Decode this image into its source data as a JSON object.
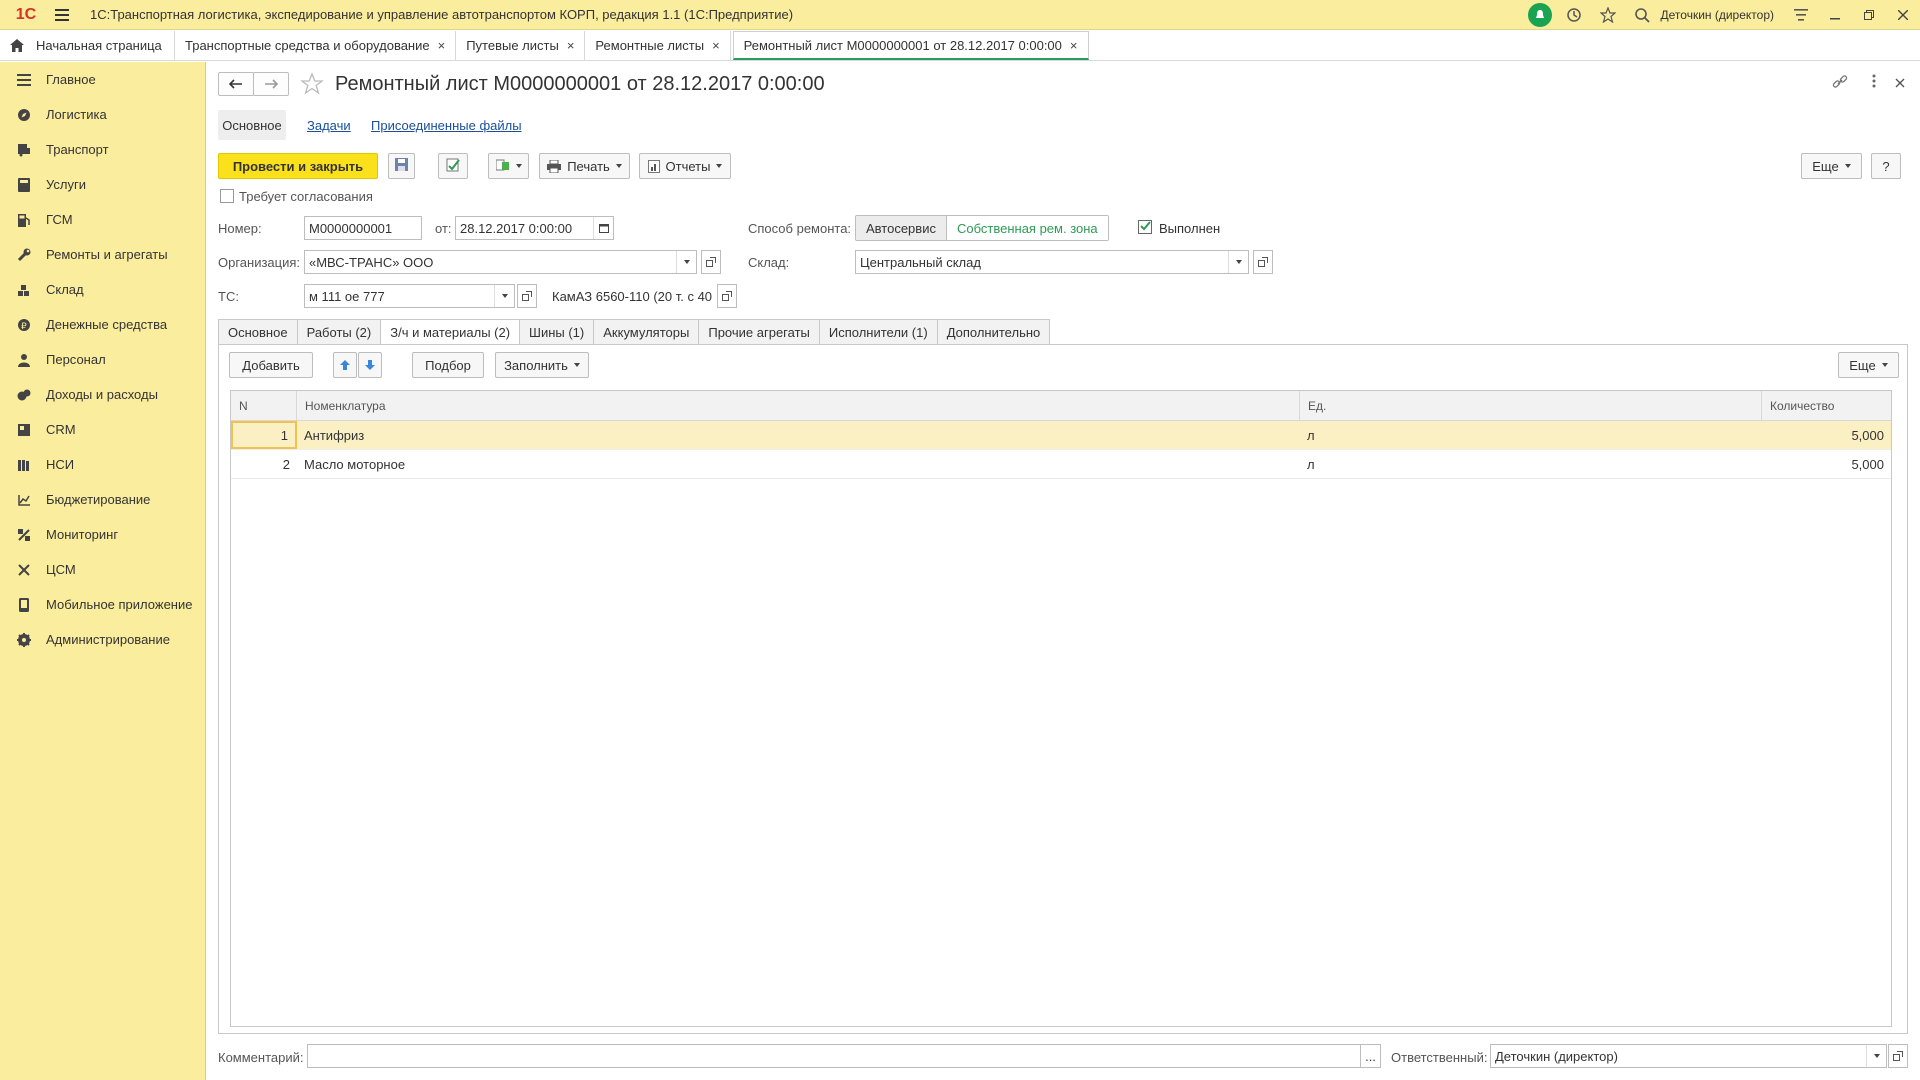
{
  "app": {
    "logo": "1С",
    "title": "1С:Транспортная логистика, экспедирование и управление автотранспортом КОРП, редакция 1.1  (1С:Предприятие)",
    "user": "Деточкин (директор)"
  },
  "tabs": [
    {
      "label": "Начальная страница"
    },
    {
      "label": "Транспортные средства и оборудование",
      "close": "×"
    },
    {
      "label": "Путевые листы",
      "close": "×"
    },
    {
      "label": "Ремонтные листы",
      "close": "×"
    },
    {
      "label": "Ремонтный лист М0000000001 от 28.12.2017 0:00:00",
      "close": "×"
    }
  ],
  "sidebar": {
    "items": [
      {
        "label": "Главное",
        "icon": "menu-lines-icon"
      },
      {
        "label": "Логистика",
        "icon": "compass-icon"
      },
      {
        "label": "Транспорт",
        "icon": "truck-icon"
      },
      {
        "label": "Услуги",
        "icon": "calculator-icon"
      },
      {
        "label": "ГСМ",
        "icon": "fuel-icon"
      },
      {
        "label": "Ремонты и агрегаты",
        "icon": "wrench-icon"
      },
      {
        "label": "Склад",
        "icon": "warehouse-icon"
      },
      {
        "label": "Денежные средства",
        "icon": "money-icon"
      },
      {
        "label": "Персонал",
        "icon": "person-icon"
      },
      {
        "label": "Доходы и расходы",
        "icon": "coins-icon"
      },
      {
        "label": "CRM",
        "icon": "crm-icon"
      },
      {
        "label": "НСИ",
        "icon": "books-icon"
      },
      {
        "label": "Бюджетирование",
        "icon": "budget-icon"
      },
      {
        "label": "Мониторинг",
        "icon": "satellite-icon"
      },
      {
        "label": "ЦСМ",
        "icon": "tools-icon"
      },
      {
        "label": "Мобильное приложение",
        "icon": "mobile-icon"
      },
      {
        "label": "Администрирование",
        "icon": "gear-icon"
      }
    ]
  },
  "doc": {
    "title": "Ремонтный лист М0000000001 от 28.12.2017 0:00:00",
    "subtabs": {
      "main": "Основное",
      "tasks": "Задачи",
      "files": "Присоединенные файлы"
    },
    "toolbar": {
      "post_close": "Провести и закрыть",
      "print": "Печать",
      "reports": "Отчеты",
      "more": "Еще",
      "help": "?"
    },
    "requires_approval": "Требует согласования",
    "number_label": "Номер:",
    "number": "М0000000001",
    "date_label": "от:",
    "date": "28.12.2017  0:00:00",
    "org_label": "Организация:",
    "org": "«МВС-ТРАНС» ООО",
    "vehicle_label": "ТС:",
    "vehicle": "м 111 ое 777",
    "vehicle_model": "КамАЗ 6560-110 (20 т. с 40",
    "repair_method_label": "Способ ремонта:",
    "repair_method_options": [
      "Автосервис",
      "Собственная рем. зона"
    ],
    "done_label": "Выполнен",
    "done": true,
    "warehouse_label": "Склад:",
    "warehouse": "Центральный склад",
    "ptabs": [
      "Основное",
      "Работы (2)",
      "З/ч и материалы (2)",
      "Шины (1)",
      "Аккумуляторы",
      "Прочие агрегаты",
      "Исполнители (1)",
      "Дополнительно"
    ],
    "table_toolbar": {
      "add": "Добавить",
      "pick": "Подбор",
      "fill": "Заполнить",
      "more": "Еще"
    },
    "table": {
      "columns": [
        "N",
        "Номенклатура",
        "Ед.",
        "Количество"
      ],
      "rows": [
        {
          "n": "1",
          "name": "Антифриз",
          "unit": "л",
          "qty": "5,000"
        },
        {
          "n": "2",
          "name": "Масло моторное",
          "unit": "л",
          "qty": "5,000"
        }
      ]
    },
    "comment_label": "Комментарий:",
    "comment": "",
    "comment_btn": "...",
    "responsible_label": "Ответственный:",
    "responsible": "Деточкин (директор)"
  }
}
